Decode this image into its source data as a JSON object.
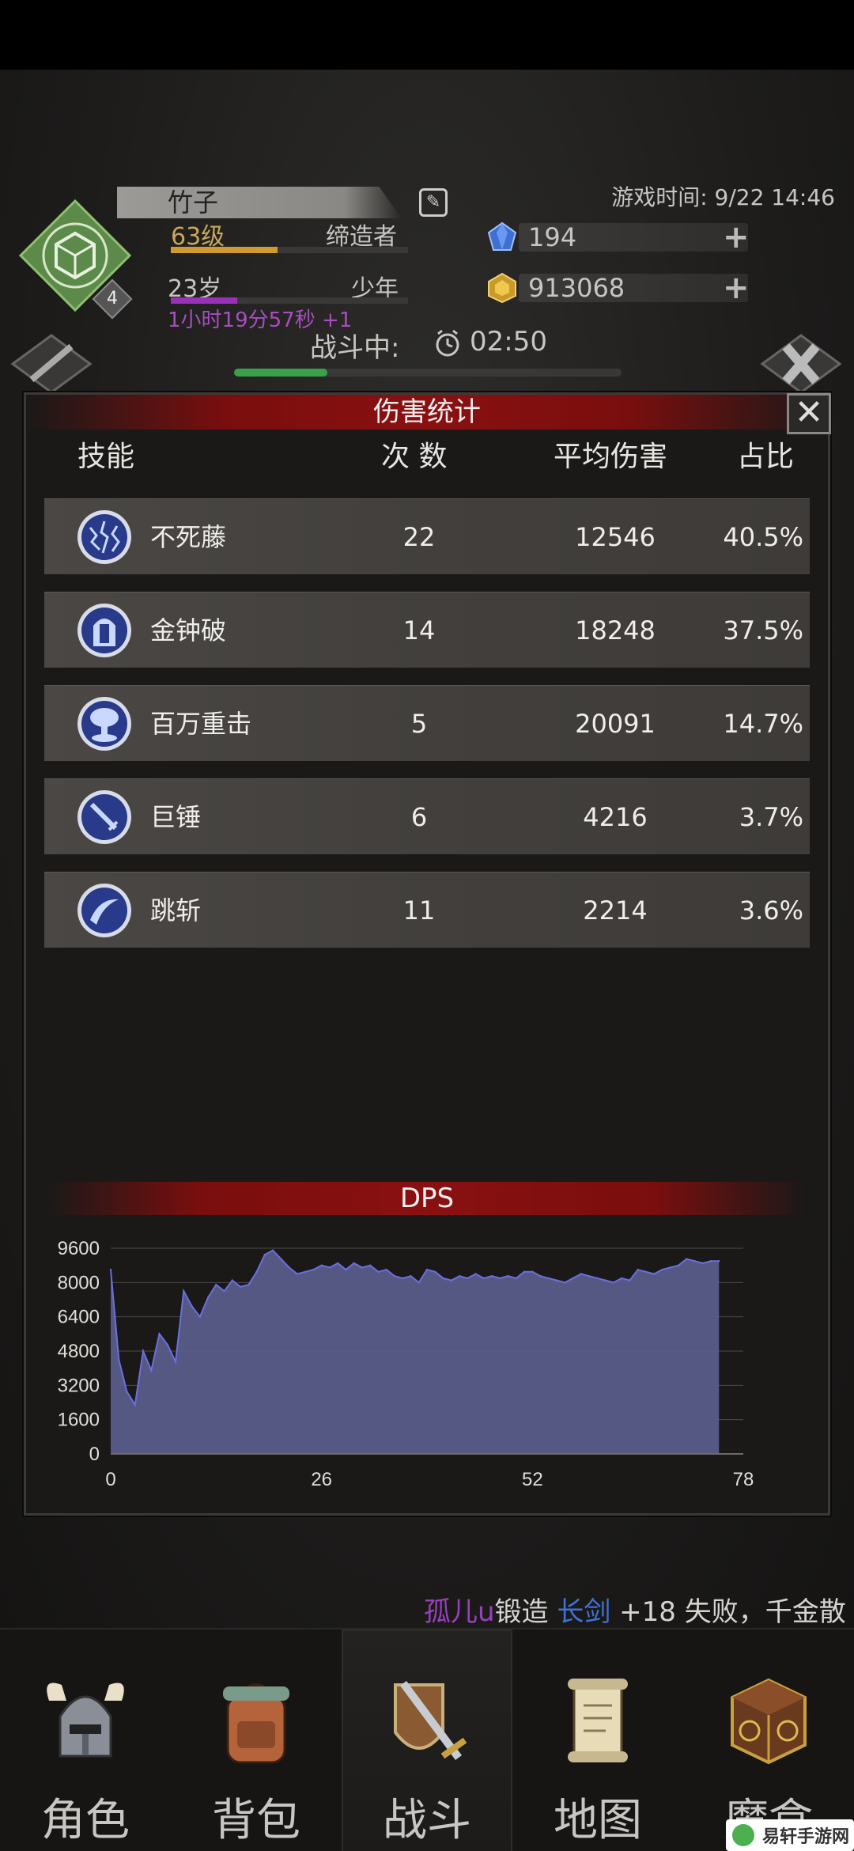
{
  "player": {
    "name": "竹子",
    "level": "63级",
    "profession": "缔造者",
    "age": "23岁",
    "stage": "少年",
    "age_timer": "1小时19分57秒 +1",
    "rank_badge": "4"
  },
  "game_time": "游戏时间: 9/22 14:46",
  "resources": {
    "diamond": "194",
    "gold": "913068"
  },
  "battle": {
    "label": "战斗中:",
    "time": "02:50",
    "progress": 0.24
  },
  "modal": {
    "title": "伤害统计",
    "close": "✕",
    "headers": {
      "skill": "技能",
      "count": "次 数",
      "avg": "平均伤害",
      "pct": "占比"
    },
    "rows": [
      {
        "name": "不死藤",
        "count": "22",
        "avg": "12546",
        "pct": "40.5%",
        "icon": "lightning-vines-icon"
      },
      {
        "name": "金钟破",
        "count": "14",
        "avg": "18248",
        "pct": "37.5%",
        "icon": "golden-bell-icon"
      },
      {
        "name": "百万重击",
        "count": "5",
        "avg": "20091",
        "pct": "14.7%",
        "icon": "mushroom-cloud-icon"
      },
      {
        "name": "巨锤",
        "count": "6",
        "avg": "4216",
        "pct": "3.7%",
        "icon": "sword-icon"
      },
      {
        "name": "跳斩",
        "count": "11",
        "avg": "2214",
        "pct": "3.6%",
        "icon": "slash-icon"
      }
    ],
    "dps_title": "DPS"
  },
  "chart_data": {
    "type": "area",
    "title": "DPS",
    "x_ticks": [
      "0",
      "26",
      "52",
      "78"
    ],
    "y_ticks": [
      "0",
      "1600",
      "3200",
      "4800",
      "6400",
      "8000",
      "9600"
    ],
    "xlim": [
      0,
      78
    ],
    "ylim": [
      0,
      9600
    ],
    "grid": true,
    "fill_color": "#5a5c8a",
    "line_color": "#6a6fe0",
    "x": [
      0,
      1,
      2,
      3,
      4,
      5,
      6,
      7,
      8,
      9,
      10,
      11,
      12,
      13,
      14,
      15,
      16,
      17,
      18,
      19,
      20,
      21,
      22,
      23,
      24,
      25,
      26,
      27,
      28,
      29,
      30,
      31,
      32,
      33,
      34,
      35,
      36,
      37,
      38,
      39,
      40,
      41,
      42,
      43,
      44,
      45,
      46,
      47,
      48,
      49,
      50,
      51,
      52,
      53,
      54,
      55,
      56,
      57,
      58,
      59,
      60,
      61,
      62,
      63,
      64,
      65,
      66,
      67,
      68,
      69,
      70,
      71,
      72,
      73,
      74,
      75
    ],
    "y": [
      8600,
      4400,
      2900,
      2300,
      4800,
      3900,
      5600,
      5100,
      4300,
      7600,
      6900,
      6400,
      7300,
      7900,
      7600,
      8100,
      7800,
      7900,
      8500,
      9300,
      9500,
      9100,
      8700,
      8400,
      8500,
      8600,
      8800,
      8700,
      8900,
      8600,
      8900,
      8700,
      8800,
      8500,
      8600,
      8300,
      8200,
      8300,
      8000,
      8600,
      8500,
      8200,
      8100,
      8300,
      8200,
      8400,
      8200,
      8300,
      8200,
      8300,
      8200,
      8500,
      8500,
      8300,
      8200,
      8100,
      8000,
      8200,
      8400,
      8300,
      8200,
      8100,
      8000,
      8200,
      8100,
      8600,
      8500,
      8400,
      8600,
      8700,
      8800,
      9100,
      9000,
      8900,
      9000,
      9000
    ]
  },
  "ticker": {
    "player": "孤儿u",
    "action": "锻造 ",
    "item": "长剑",
    "result": " +18 失败，千金散"
  },
  "nav": [
    {
      "label": "角色",
      "icon": "horned-helmet-icon"
    },
    {
      "label": "背包",
      "icon": "backpack-icon"
    },
    {
      "label": "战斗",
      "icon": "sword-shield-icon"
    },
    {
      "label": "地图",
      "icon": "scroll-map-icon"
    },
    {
      "label": "魔盒",
      "icon": "magic-box-icon"
    }
  ],
  "watermark": "易轩手游网",
  "colors": {
    "accent_red": "#8a1010",
    "level_gold": "#c9a85a",
    "age_purple": "#9a2fb8"
  }
}
